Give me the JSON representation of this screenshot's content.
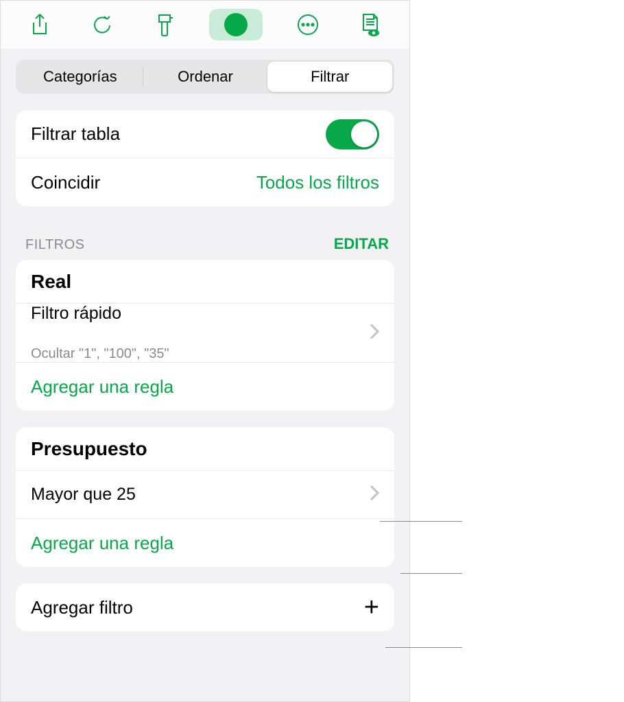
{
  "toolbar": {
    "icons": [
      "share-icon",
      "undo-icon",
      "brush-icon",
      "filter-icon",
      "more-icon",
      "document-icon"
    ]
  },
  "segmented": {
    "items": [
      "Categorías",
      "Ordenar",
      "Filtrar"
    ],
    "active": 2
  },
  "filterTable": {
    "label": "Filtrar tabla",
    "on": true
  },
  "match": {
    "label": "Coincidir",
    "value": "Todos los filtros"
  },
  "sectionHeader": {
    "title": "FILTROS",
    "edit": "EDITAR"
  },
  "groups": [
    {
      "title": "Real",
      "quickFilter": {
        "label": "Filtro rápido",
        "detail": "Ocultar \"1\", \"100\", \"35\""
      },
      "addRule": "Agregar una regla"
    },
    {
      "title": "Presupuesto",
      "rule": "Mayor que 25",
      "addRule": "Agregar una regla"
    }
  ],
  "addFilter": "Agregar filtro"
}
